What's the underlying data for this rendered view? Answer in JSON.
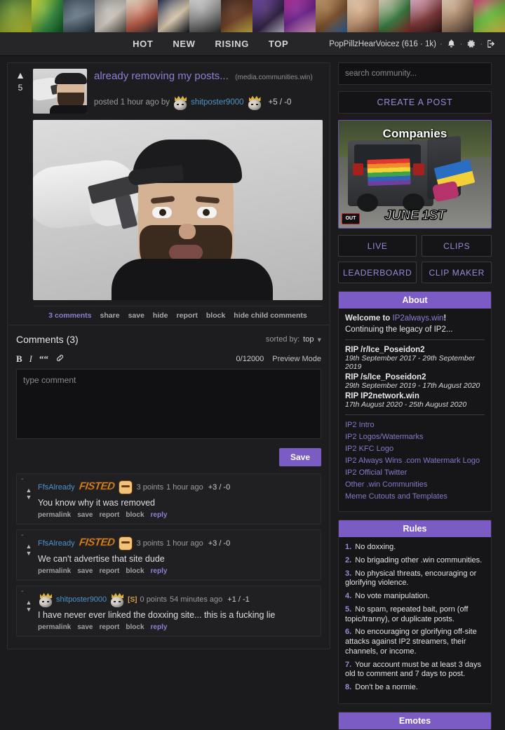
{
  "nav": {
    "links": [
      "HOT",
      "NEW",
      "RISING",
      "TOP"
    ],
    "user": "PopPillzHearVoicez (616 · 1k)",
    "icons": [
      "notifications-bell-icon",
      "settings-gear-icon",
      "logout-icon"
    ]
  },
  "post": {
    "score": "5",
    "title": "already removing my posts...",
    "domain": "(media.communities.win)",
    "posted_prefix": "posted 1 hour ago by",
    "author": "shitposter9000",
    "vote_breakdown": "+5 / -0",
    "actions": [
      "3 comments",
      "share",
      "save",
      "hide",
      "report",
      "block",
      "hide child comments"
    ]
  },
  "comments_section": {
    "title": "Comments (3)",
    "sorted_by_label": "sorted by:",
    "sorted_by_value": "top",
    "editor": {
      "format_buttons": [
        "bold-icon",
        "italic-icon",
        "quote-icon",
        "link-icon"
      ],
      "char_count": "0/12000",
      "preview_label": "Preview Mode",
      "placeholder": "type comment",
      "value": "",
      "save_label": "Save"
    },
    "comments": [
      {
        "collapse": "-",
        "author": "FfsAlready",
        "flair": "FISTED",
        "op_tag": "",
        "points": "3 points",
        "time": "1 hour ago",
        "score": "+3 / -0",
        "text": "You know why it was removed",
        "actions": [
          "permalink",
          "save",
          "report",
          "block",
          "reply"
        ]
      },
      {
        "collapse": "-",
        "author": "FfsAlready",
        "flair": "FISTED",
        "op_tag": "",
        "points": "3 points",
        "time": "1 hour ago",
        "score": "+3 / -0",
        "text": "We can't advertise that site dude",
        "actions": [
          "permalink",
          "save",
          "report",
          "block",
          "reply"
        ]
      },
      {
        "collapse": "-",
        "author": "shitposter9000",
        "flair": "",
        "op_tag": "[S]",
        "points": "0 points",
        "time": "54 minutes ago",
        "score": "+1 / -1",
        "text": "I have never ever linked the doxxing site... this is a fucking lie",
        "actions": [
          "permalink",
          "save",
          "report",
          "block",
          "reply"
        ]
      }
    ]
  },
  "sidebar": {
    "search_placeholder": "search community...",
    "create_post_label": "CREATE A POST",
    "banner": {
      "caption_top": "Companies",
      "caption_bottom": "JUNE 1ST",
      "logo_text": "OUT"
    },
    "buttons": [
      "LIVE",
      "CLIPS",
      "LEADERBOARD",
      "CLIP MAKER"
    ],
    "about": {
      "heading": "About",
      "welcome_prefix": "Welcome to ",
      "welcome_link": "IP2always.win",
      "welcome_suffix": "!",
      "tagline": "Continuing the legacy of IP2...",
      "rips": [
        {
          "title": "RIP /r/Ice_Poseidon2",
          "dates": "19th September 2017 - 29th September 2019"
        },
        {
          "title": "RIP /s/Ice_Poseidon2",
          "dates": "29th September 2019 - 17th August 2020"
        },
        {
          "title": "RIP IP2network.win",
          "dates": "17th August 2020 - 25th August 2020"
        }
      ],
      "links": [
        "IP2 Intro",
        "IP2 Logos/Watermarks",
        "IP2 KFC Logo",
        "IP2 Always Wins .com Watermark Logo",
        "IP2 Official Twitter",
        "Other .win Communities",
        "Meme Cutouts and Templates"
      ]
    },
    "rules": {
      "heading": "Rules",
      "items": [
        "No doxxing.",
        "No brigading other .win communities.",
        "No physical threats, encouraging or glorifying violence.",
        "No vote manipulation.",
        "No spam, repeated bait, porn (off topic/tranny), or duplicate posts.",
        "No encouraging or glorifying off-site attacks against IP2 streamers, their channels, or income.",
        "Your account must be at least 3 days old to comment and 7 days to post.",
        "Don't be a normie."
      ]
    },
    "emotes": {
      "heading": "Emotes"
    }
  },
  "colors": {
    "accent": "#7a5cc4",
    "link": "#8f7fd4",
    "author": "#4f93c7",
    "bg": "#1b1b1d",
    "panel": "#1d1d1f"
  }
}
